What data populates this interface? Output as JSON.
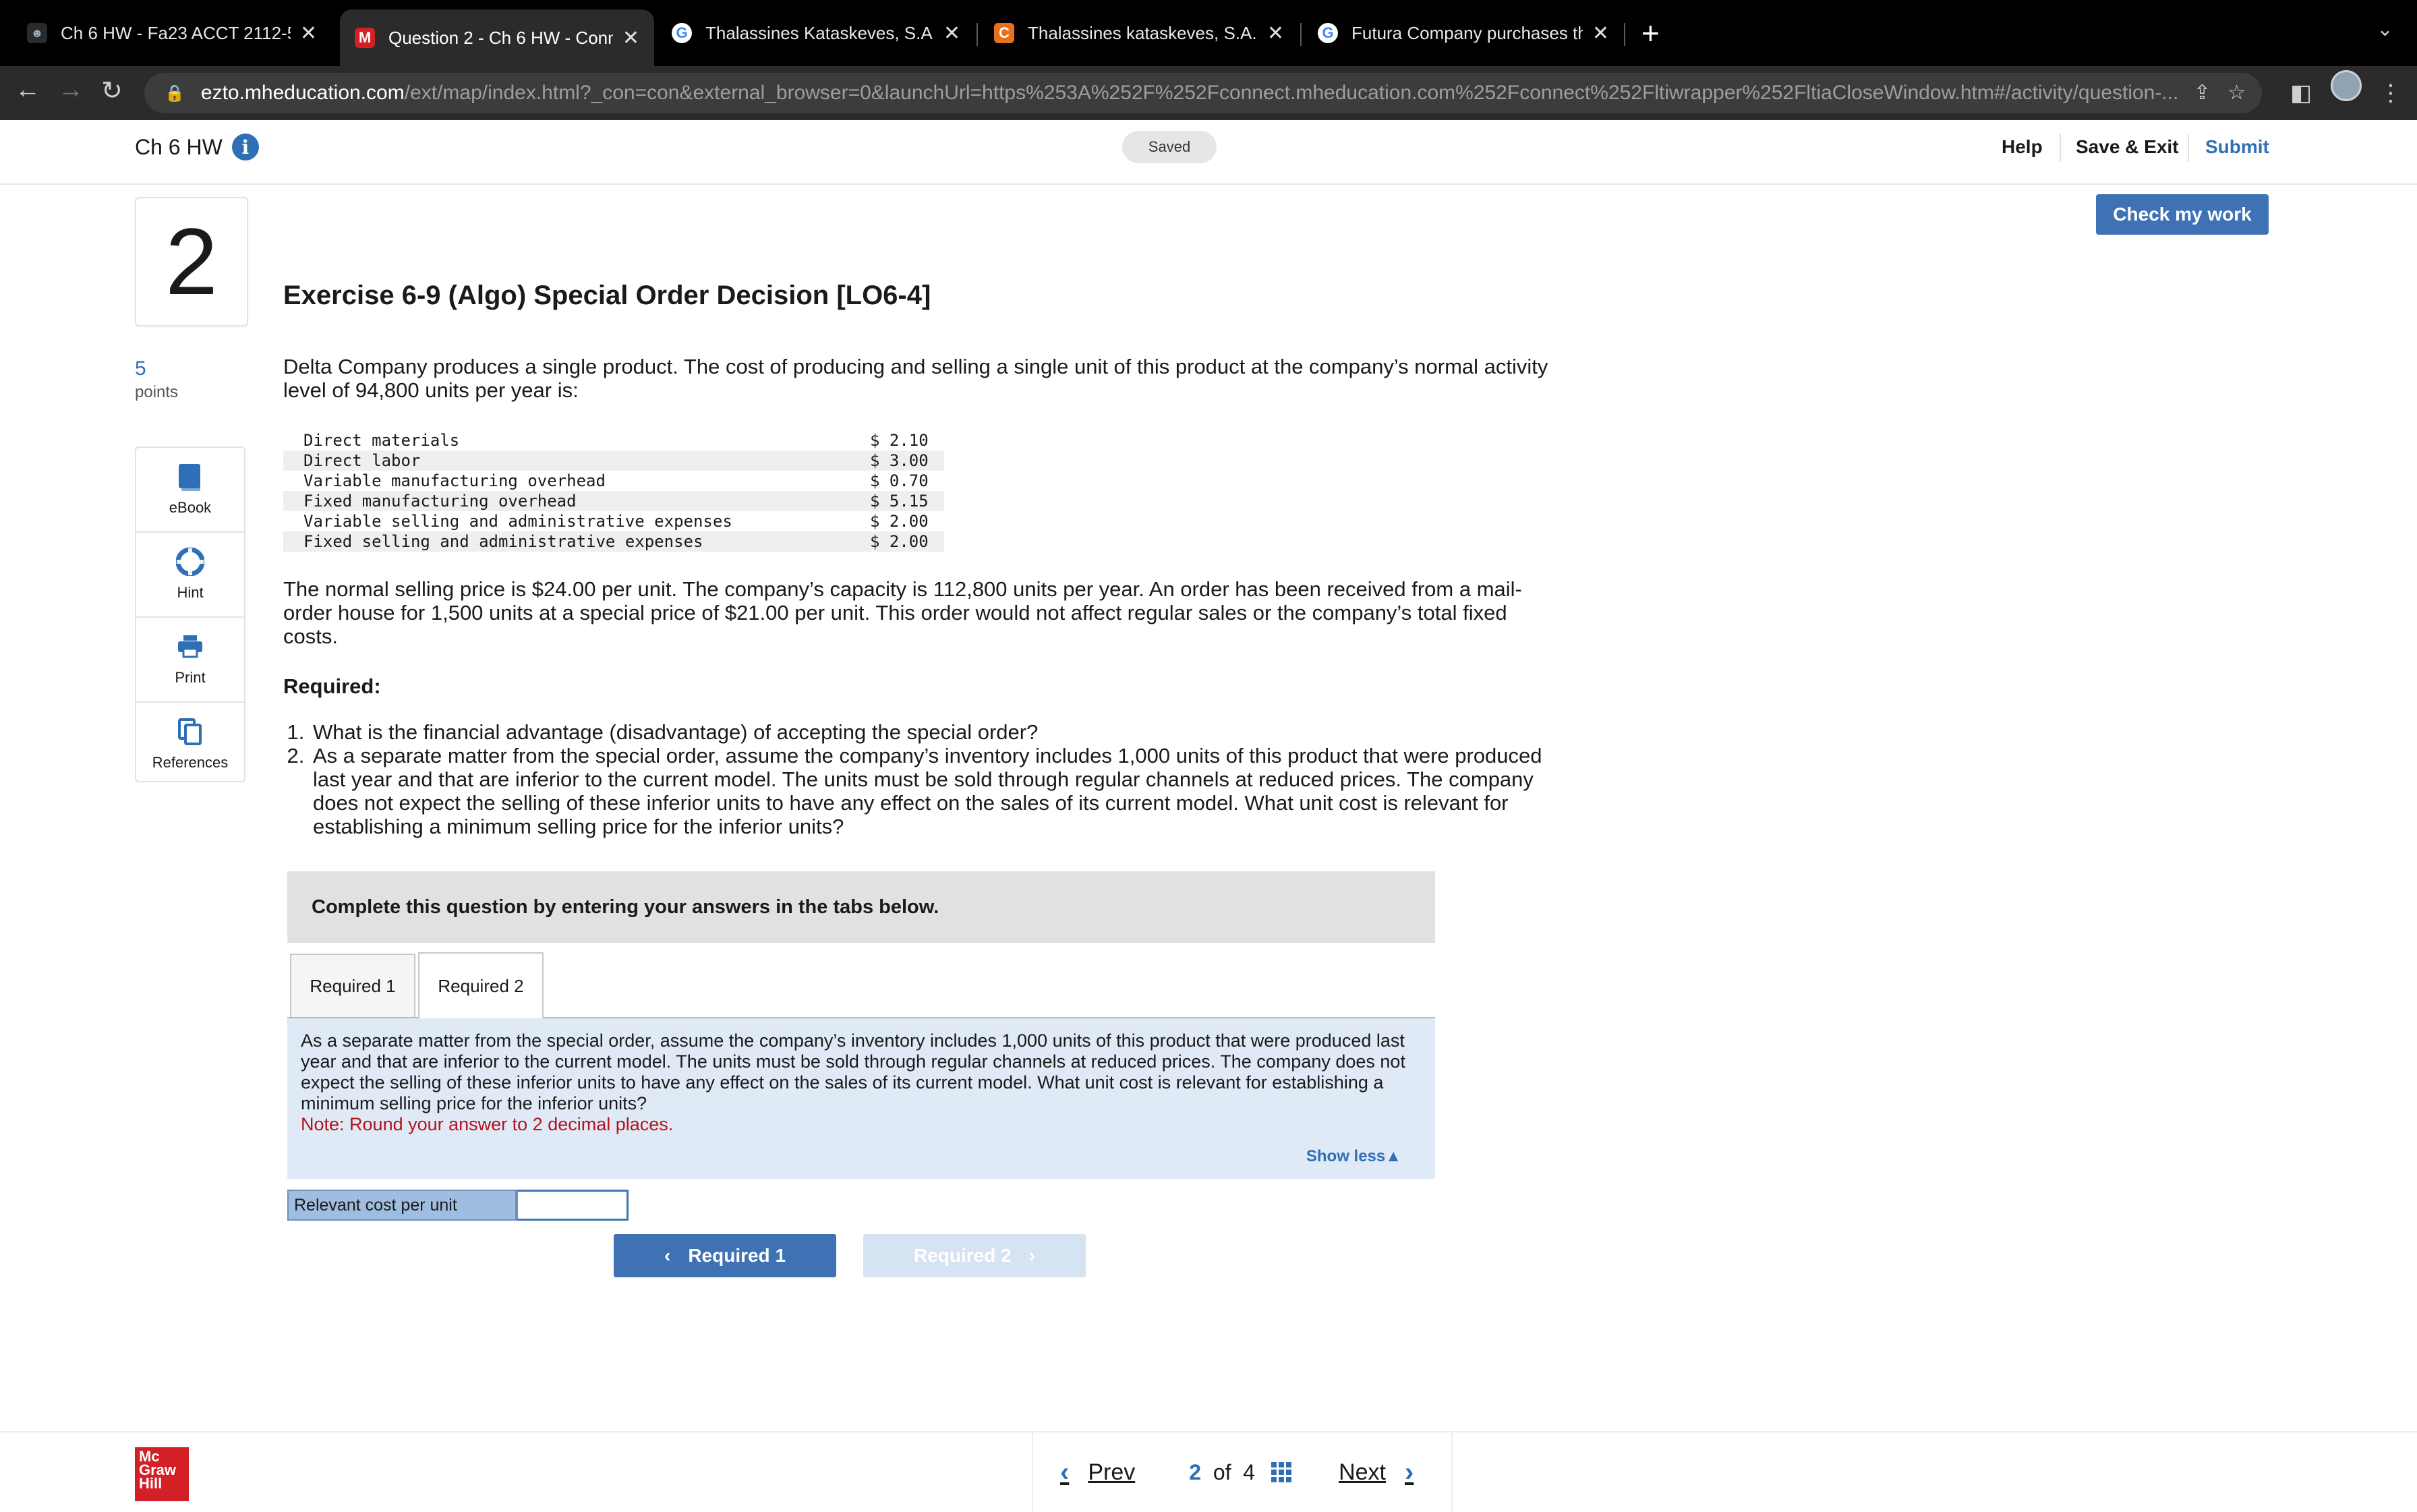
{
  "browser": {
    "tabs": [
      {
        "title": "Ch 6 HW - Fa23 ACCT 2112-5",
        "favicon_color": "#2b2b2b"
      },
      {
        "title": "Question 2 - Ch 6 HW - Conne",
        "favicon_color": "#d31f26",
        "favicon_letter": "M"
      },
      {
        "title": "Thalassines Kataskeves, S.A.,",
        "favicon_color": "#ffffff",
        "favicon_letter": "G"
      },
      {
        "title": "Thalassines kataskeves, S.A.,",
        "favicon_color": "#e8701a",
        "favicon_letter": "C"
      },
      {
        "title": "Futura Company purchases th",
        "favicon_color": "#ffffff",
        "favicon_letter": "G"
      }
    ],
    "url_domain": "ezto.mheducation.com",
    "url_path": "/ext/map/index.html?_con=con&external_browser=0&launchUrl=https%253A%252F%252Fconnect.mheducation.com%252Fconnect%252Fltiwrapper%252FltiaCloseWindow.htm#/activity/question-..."
  },
  "header": {
    "assignment": "Ch 6 HW",
    "saved": "Saved",
    "help": "Help",
    "save_exit": "Save & Exit",
    "submit": "Submit"
  },
  "question": {
    "number": "2",
    "points_value": "5",
    "points_label": "points",
    "tools": [
      "eBook",
      "Hint",
      "Print",
      "References"
    ],
    "check_my_work": "Check my work",
    "title": "Exercise 6-9 (Algo) Special Order Decision [LO6-4]",
    "intro": "Delta Company produces a single product. The cost of producing and selling a single unit of this product at the company’s normal activity level of 94,800 units per year is:",
    "costs": [
      {
        "label": "Direct materials",
        "amount": "$ 2.10"
      },
      {
        "label": "Direct labor",
        "amount": "$ 3.00"
      },
      {
        "label": "Variable manufacturing overhead",
        "amount": "$ 0.70"
      },
      {
        "label": "Fixed manufacturing overhead",
        "amount": "$ 5.15"
      },
      {
        "label": "Variable selling and administrative expenses",
        "amount": "$ 2.00"
      },
      {
        "label": "Fixed selling and administrative expenses",
        "amount": "$ 2.00"
      }
    ],
    "scenario": "The normal selling price is $24.00 per unit. The company’s capacity is 112,800 units per year. An order has been received from a mail-order house for 1,500 units at a special price of $21.00 per unit. This order would not affect regular sales or the company’s total fixed costs.",
    "required_heading": "Required:",
    "required_items": [
      "What is the financial advantage (disadvantage) of accepting the special order?",
      "As a separate matter from the special order, assume the company’s inventory includes 1,000 units of this product that were produced last year and that are inferior to the current model. The units must be sold through regular channels at reduced prices. The company does not expect the selling of these inferior units to have any effect on the sales of its current model. What unit cost is relevant for establishing a minimum selling price for the inferior units?"
    ],
    "banner": "Complete this question by entering your answers in the tabs below.",
    "tabs": [
      "Required 1",
      "Required 2"
    ],
    "active_tab": "Required 2",
    "panel_text": "As a separate matter from the special order, assume the company’s inventory includes 1,000 units of this product that were produced last year and that are inferior to the current model. The units must be sold through regular channels at reduced prices. The company does not expect the selling of these inferior units to have any effect on the sales of its current model. What unit cost is relevant for establishing a minimum selling price for the inferior units?",
    "panel_note": "Note: Round your answer to 2 decimal places.",
    "show_less": "Show less",
    "answer_label": "Relevant cost per unit",
    "answer_value": "",
    "nav_prev": "Required 1",
    "nav_next": "Required 2"
  },
  "footer": {
    "logo": [
      "Mc",
      "Graw",
      "Hill"
    ],
    "prev": "Prev",
    "current": "2",
    "of": "of",
    "total": "4",
    "next": "Next"
  },
  "colors": {
    "accent": "#3f72b5",
    "panel": "#dfeaf6",
    "note": "#b5121b",
    "brand": "#d31f26"
  }
}
